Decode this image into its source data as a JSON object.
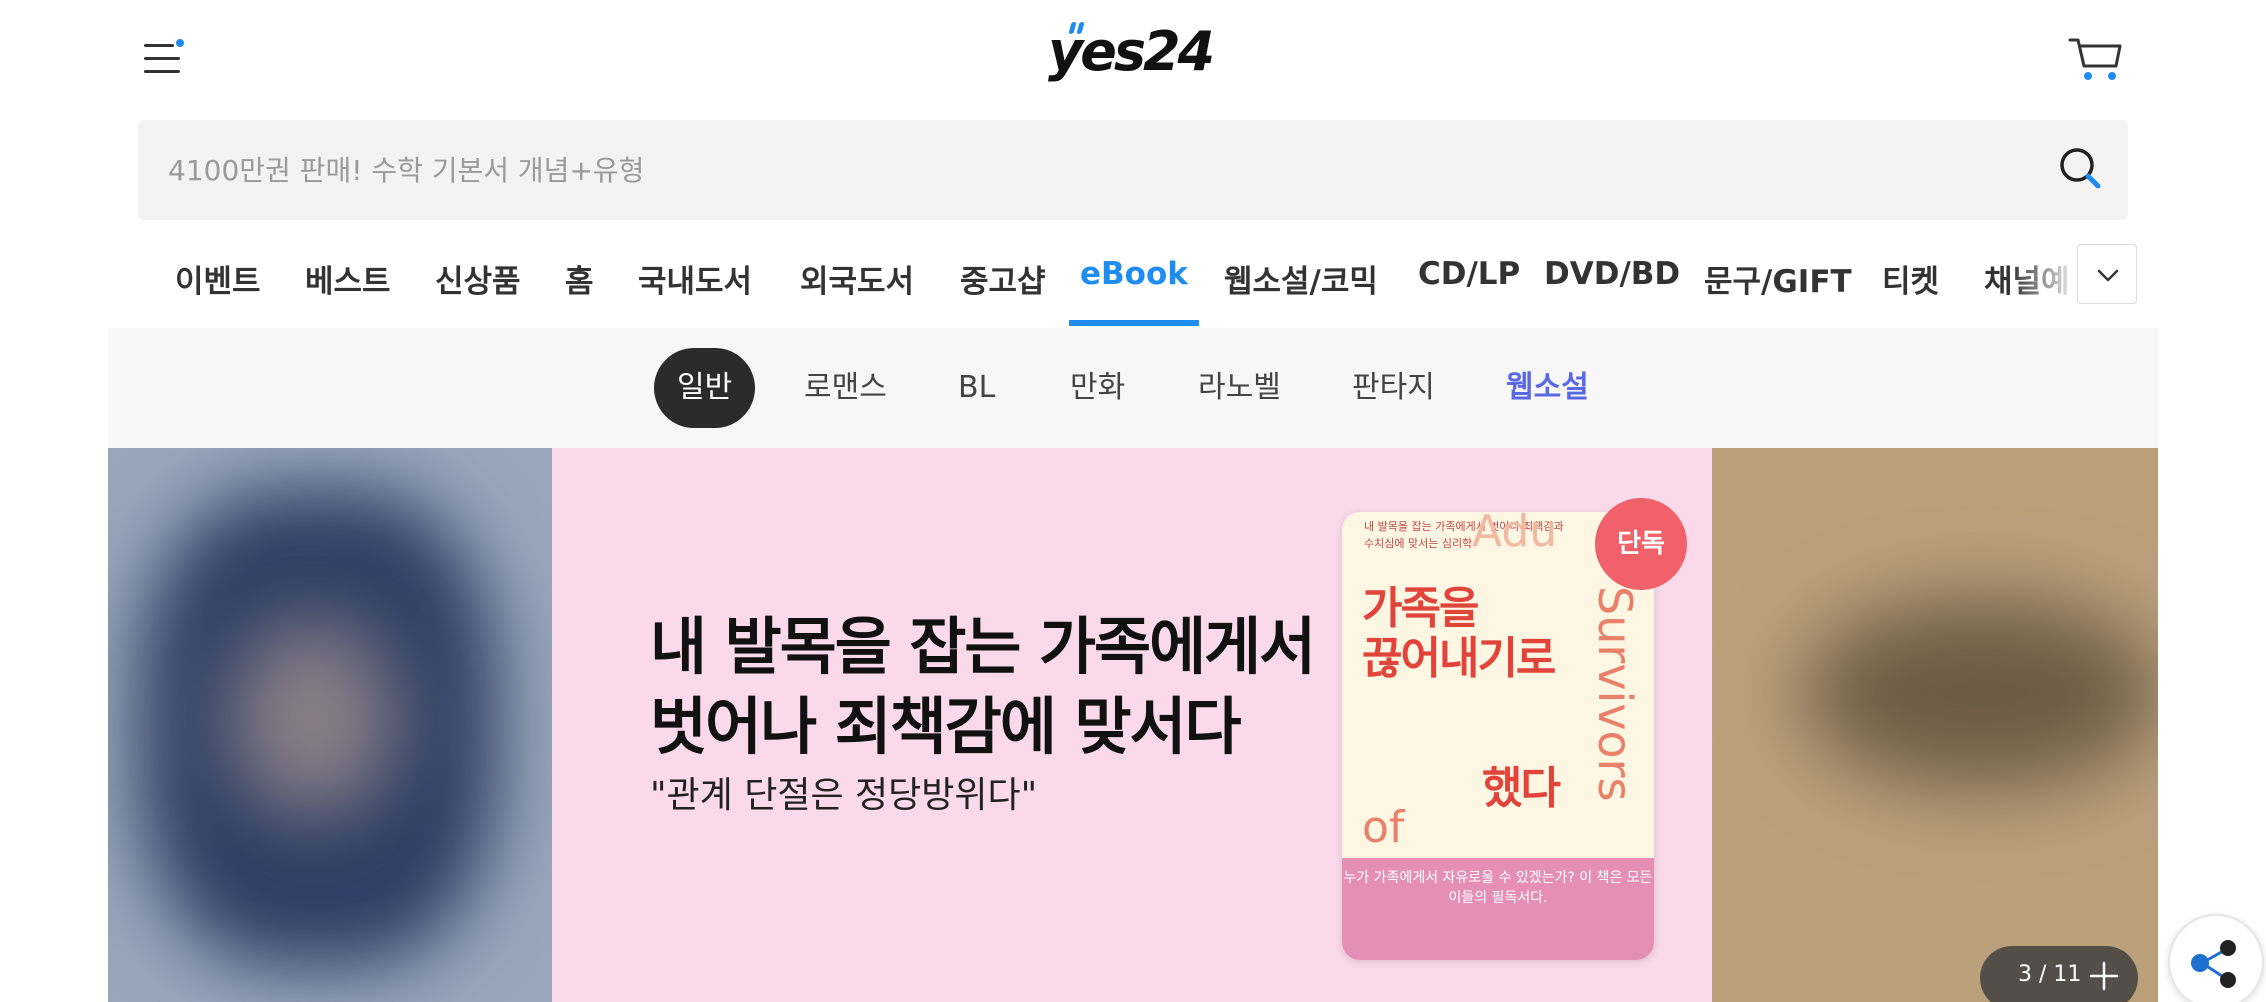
{
  "header": {
    "logo_text": "yes24",
    "menu_icon": "menu-icon",
    "cart_icon": "cart-icon"
  },
  "search": {
    "placeholder": "4100만권 판매! 수학 기본서 개념+유형",
    "icon": "search-icon"
  },
  "nav": {
    "items": [
      "이벤트",
      "베스트",
      "신상품",
      "홈",
      "국내도서",
      "외국도서",
      "중고샵",
      "eBook",
      "웹소설/코믹",
      "CD/LP",
      "DVD/BD",
      "문구/GIFT",
      "티켓",
      "채널예"
    ],
    "active": "eBook",
    "more_icon": "chevron-down-icon"
  },
  "sub_nav": {
    "items": [
      "일반",
      "로맨스",
      "BL",
      "만화",
      "라노벨",
      "판타지",
      "웹소설"
    ],
    "selected": "일반",
    "highlight": "웹소설"
  },
  "banner": {
    "headline_line1": "내 발목을 잡는 가족에게서",
    "headline_line2": "벗어나 죄책감에 맞서다",
    "quote": "\"관계 단절은 정당방위다\"",
    "badge": "단독",
    "book": {
      "subtitle": "내 발목을 잡는 가족에게서 벗어나 죄책감과 수치심에 맞서는 심리학",
      "title_1": "가족을",
      "title_2": "끊어내기로",
      "title_3": "했다",
      "english_1": "Adu",
      "english_2": "Survivors",
      "english_3": "of",
      "description": "누가 가족에게서 자유로울 수 있겠는가? 이 책은 모든 이들의 필독서다."
    },
    "pager": {
      "current": 3,
      "total": 11,
      "text": "3 / 11"
    },
    "colors": {
      "main_bg": "#f9d9ea",
      "badge": "#f0616a",
      "book_title": "#e0443a"
    }
  },
  "share_icon": "share-icon",
  "colors": {
    "accent": "#1f8cf0",
    "highlight": "#5a68e6",
    "selected_bg": "#2b2b2b"
  }
}
